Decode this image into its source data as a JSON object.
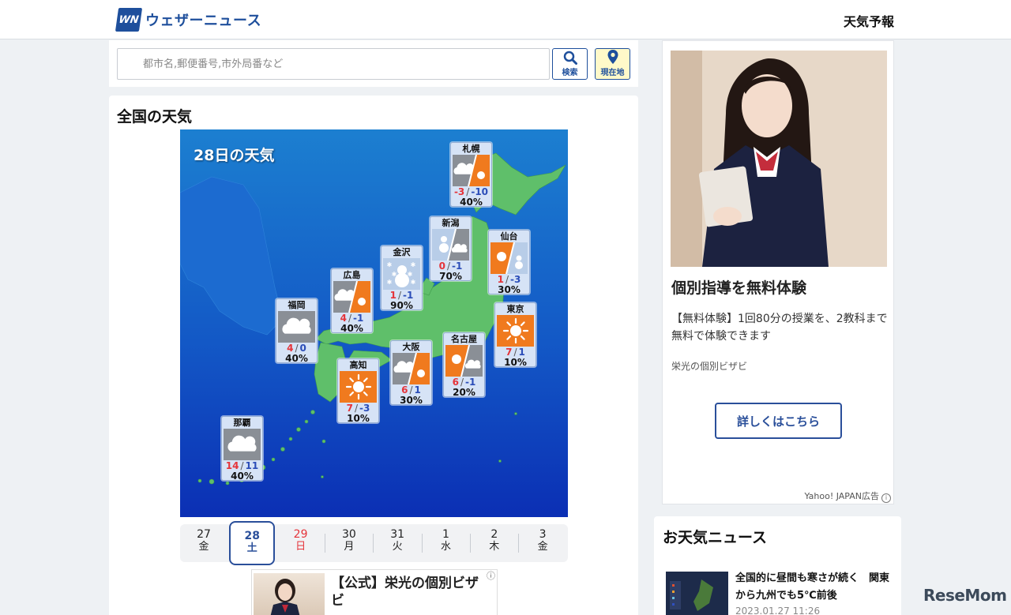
{
  "header": {
    "logo_mark": "WN",
    "logo_text": "ウェザーニュース",
    "nav_label": "天気予報"
  },
  "search": {
    "placeholder": "都市名,郵便番号,市外局番など",
    "search_label": "検索",
    "location_label": "現在地"
  },
  "weather": {
    "section_title": "全国の天気",
    "map_title": "28日の天気",
    "cities": [
      {
        "name": "札幌",
        "icon": "cloudy-then-sunny-icon",
        "hi": "-3",
        "lo": "-10",
        "pop": "40%"
      },
      {
        "name": "新潟",
        "icon": "snow-then-cloudy-icon",
        "hi": "0",
        "lo": "-1",
        "pop": "70%"
      },
      {
        "name": "仙台",
        "icon": "sunny-then-snow-icon",
        "hi": "1",
        "lo": "-3",
        "pop": "30%"
      },
      {
        "name": "金沢",
        "icon": "snow-icon",
        "hi": "1",
        "lo": "-1",
        "pop": "90%"
      },
      {
        "name": "広島",
        "icon": "cloudy-then-sunny-icon",
        "hi": "4",
        "lo": "-1",
        "pop": "40%"
      },
      {
        "name": "福岡",
        "icon": "cloudy-icon",
        "hi": "4",
        "lo": "0",
        "pop": "40%"
      },
      {
        "name": "東京",
        "icon": "sunny-icon",
        "hi": "7",
        "lo": "1",
        "pop": "10%"
      },
      {
        "name": "大阪",
        "icon": "cloudy-then-sunny-icon",
        "hi": "6",
        "lo": "1",
        "pop": "30%"
      },
      {
        "name": "名古屋",
        "icon": "sunny-then-cloudy-icon",
        "hi": "6",
        "lo": "-1",
        "pop": "20%"
      },
      {
        "name": "高知",
        "icon": "sunny-icon",
        "hi": "7",
        "lo": "-3",
        "pop": "10%"
      },
      {
        "name": "那覇",
        "icon": "cloudy-icon",
        "hi": "14",
        "lo": "11",
        "pop": "40%"
      }
    ],
    "dates": [
      {
        "day": "27",
        "weekday": "金"
      },
      {
        "day": "28",
        "weekday": "土"
      },
      {
        "day": "29",
        "weekday": "日"
      },
      {
        "day": "30",
        "weekday": "月"
      },
      {
        "day": "31",
        "weekday": "火"
      },
      {
        "day": "1",
        "weekday": "水"
      },
      {
        "day": "2",
        "weekday": "木"
      },
      {
        "day": "3",
        "weekday": "金"
      }
    ],
    "selected_date": "28",
    "colors": {
      "high": "#e5343a",
      "low": "#2b4db8",
      "selected": "#2a4f9a"
    }
  },
  "bottom_ad": {
    "title": "【公式】栄光の個別ビザビ"
  },
  "side_ad": {
    "headline": "個別指導を無料体験",
    "body": "【無料体験】1回80分の授業を、2教科まで無料で体験できます",
    "sponsor": "栄光の個別ビザビ",
    "cta": "詳しくはこちら",
    "ad_label": "Yahoo! JAPAN広告"
  },
  "news": {
    "section_title": "お天気ニュース",
    "headline": "全国的に昼間も寒さが続く　関東から九州でも5℃前後",
    "date": "2023.01.27 11:26"
  },
  "watermark": "ReseMom"
}
